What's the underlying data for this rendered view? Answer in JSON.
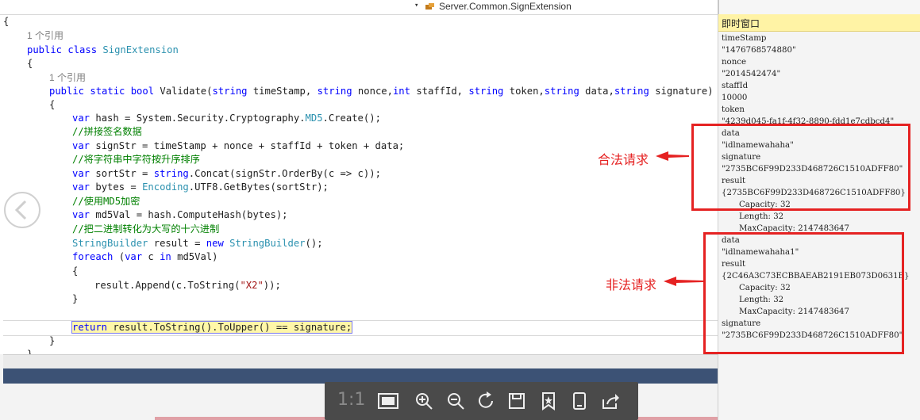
{
  "header": {
    "member_dropdown": "Server.Common.SignExtension",
    "dropdown_arrow": "▾",
    "member_icon": "class-icon"
  },
  "code": {
    "l01": "{",
    "l02_ref": "1 个引用",
    "l03_kw": "public class ",
    "l03_type": "SignExtension",
    "l04": "{",
    "l05_ref": "1 个引用",
    "l06_a": "public static bool ",
    "l06_b": "Validate(",
    "l06_c": "string",
    "l06_d": " timeStamp, ",
    "l06_e": "string",
    "l06_f": " nonce,",
    "l06_g": "int",
    "l06_h": " staffId, ",
    "l06_i": "string",
    "l06_j": " token,",
    "l06_k": "string",
    "l06_l": " data,",
    "l06_m": "string",
    "l06_n": " signature)",
    "l07": "{",
    "l08_a": "var",
    "l08_b": " hash = System.Security.Cryptography.",
    "l08_c": "MD5",
    "l08_d": ".Create();",
    "l09": "//拼接签名数据",
    "l10_a": "var",
    "l10_b": " signStr = timeStamp + nonce + staffId + token + data;",
    "l11": "//将字符串中字符按升序排序",
    "l12_a": "var",
    "l12_b": " sortStr = ",
    "l12_c": "string",
    "l12_d": ".Concat(signStr.OrderBy(c => c));",
    "l13_a": "var",
    "l13_b": " bytes = ",
    "l13_c": "Encoding",
    "l13_d": ".UTF8.GetBytes(sortStr);",
    "l14": "//使用MD5加密",
    "l15_a": "var",
    "l15_b": " md5Val = hash.ComputeHash(bytes);",
    "l16": "//把二进制转化为大写的十六进制",
    "l17_a": "StringBuilder",
    "l17_b": " result = ",
    "l17_c": "new",
    "l17_d": " ",
    "l17_e": "StringBuilder",
    "l17_f": "();",
    "l18_a": "foreach",
    "l18_b": " (",
    "l18_c": "var",
    "l18_d": " c ",
    "l18_e": "in",
    "l18_f": " md5Val)",
    "l19": "{",
    "l20_a": "result.Append(c.ToString(",
    "l20_b": "\"X2\"",
    "l20_c": "));",
    "l21": "}",
    "l22_a": "return",
    "l22_b": " result.ToString().ToUpper() == signature;",
    "l23": "}",
    "l24": "}"
  },
  "immediate": {
    "title": "即时窗口",
    "lines": [
      "timeStamp",
      "\"1476768574880\"",
      "nonce",
      "\"2014542474\"",
      "staffId",
      "10000",
      "token",
      "\"4239d045-fa1f-4f32-8890-fdd1e7cdbcd4\"",
      "data",
      "\"idlnamewahaha\"",
      "signature",
      "\"2735BC6F99D233D468726C1510ADFF80\"",
      "result",
      "{2735BC6F99D233D468726C1510ADFF80}",
      "Capacity: 32",
      "Length: 32",
      "MaxCapacity: 2147483647",
      "data",
      "\"idlnamewahaha1\"",
      "result",
      "{2C46A3C73ECBBAEAB2191EB073D0631E}",
      "Capacity: 32",
      "Length: 32",
      "MaxCapacity: 2147483647",
      "signature",
      "\"2735BC6F99D233D468726C1510ADFF80\""
    ]
  },
  "annotations": {
    "legal": "合法请求",
    "illegal": "非法请求",
    "color": "#e52222"
  },
  "viewer_toolbar": {
    "ratio_label": "1:1",
    "icons": [
      "fit-window-icon",
      "zoom-in-icon",
      "zoom-out-icon",
      "rotate-icon",
      "save-icon",
      "favorite-icon",
      "fullscreen-icon",
      "share-icon"
    ]
  },
  "colors": {
    "keyword": "#0000ff",
    "type": "#2b91af",
    "comment": "#008000",
    "string": "#a31515",
    "immediate_title_bg": "#fff3a5",
    "toolbar_bg": "#4a4a4a"
  }
}
